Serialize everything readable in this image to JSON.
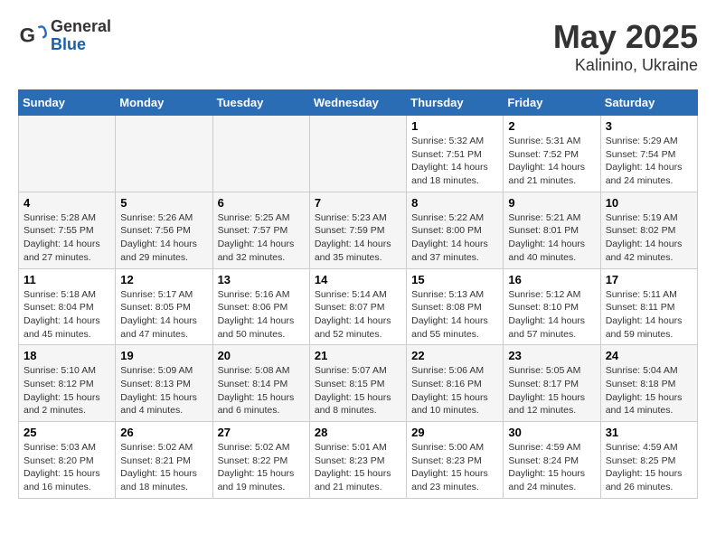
{
  "header": {
    "logo_general": "General",
    "logo_blue": "Blue",
    "title": "May 2025",
    "subtitle": "Kalinino, Ukraine"
  },
  "days_of_week": [
    "Sunday",
    "Monday",
    "Tuesday",
    "Wednesday",
    "Thursday",
    "Friday",
    "Saturday"
  ],
  "weeks": [
    [
      {
        "day": "",
        "info": ""
      },
      {
        "day": "",
        "info": ""
      },
      {
        "day": "",
        "info": ""
      },
      {
        "day": "",
        "info": ""
      },
      {
        "day": "1",
        "info": "Sunrise: 5:32 AM\nSunset: 7:51 PM\nDaylight: 14 hours\nand 18 minutes."
      },
      {
        "day": "2",
        "info": "Sunrise: 5:31 AM\nSunset: 7:52 PM\nDaylight: 14 hours\nand 21 minutes."
      },
      {
        "day": "3",
        "info": "Sunrise: 5:29 AM\nSunset: 7:54 PM\nDaylight: 14 hours\nand 24 minutes."
      }
    ],
    [
      {
        "day": "4",
        "info": "Sunrise: 5:28 AM\nSunset: 7:55 PM\nDaylight: 14 hours\nand 27 minutes."
      },
      {
        "day": "5",
        "info": "Sunrise: 5:26 AM\nSunset: 7:56 PM\nDaylight: 14 hours\nand 29 minutes."
      },
      {
        "day": "6",
        "info": "Sunrise: 5:25 AM\nSunset: 7:57 PM\nDaylight: 14 hours\nand 32 minutes."
      },
      {
        "day": "7",
        "info": "Sunrise: 5:23 AM\nSunset: 7:59 PM\nDaylight: 14 hours\nand 35 minutes."
      },
      {
        "day": "8",
        "info": "Sunrise: 5:22 AM\nSunset: 8:00 PM\nDaylight: 14 hours\nand 37 minutes."
      },
      {
        "day": "9",
        "info": "Sunrise: 5:21 AM\nSunset: 8:01 PM\nDaylight: 14 hours\nand 40 minutes."
      },
      {
        "day": "10",
        "info": "Sunrise: 5:19 AM\nSunset: 8:02 PM\nDaylight: 14 hours\nand 42 minutes."
      }
    ],
    [
      {
        "day": "11",
        "info": "Sunrise: 5:18 AM\nSunset: 8:04 PM\nDaylight: 14 hours\nand 45 minutes."
      },
      {
        "day": "12",
        "info": "Sunrise: 5:17 AM\nSunset: 8:05 PM\nDaylight: 14 hours\nand 47 minutes."
      },
      {
        "day": "13",
        "info": "Sunrise: 5:16 AM\nSunset: 8:06 PM\nDaylight: 14 hours\nand 50 minutes."
      },
      {
        "day": "14",
        "info": "Sunrise: 5:14 AM\nSunset: 8:07 PM\nDaylight: 14 hours\nand 52 minutes."
      },
      {
        "day": "15",
        "info": "Sunrise: 5:13 AM\nSunset: 8:08 PM\nDaylight: 14 hours\nand 55 minutes."
      },
      {
        "day": "16",
        "info": "Sunrise: 5:12 AM\nSunset: 8:10 PM\nDaylight: 14 hours\nand 57 minutes."
      },
      {
        "day": "17",
        "info": "Sunrise: 5:11 AM\nSunset: 8:11 PM\nDaylight: 14 hours\nand 59 minutes."
      }
    ],
    [
      {
        "day": "18",
        "info": "Sunrise: 5:10 AM\nSunset: 8:12 PM\nDaylight: 15 hours\nand 2 minutes."
      },
      {
        "day": "19",
        "info": "Sunrise: 5:09 AM\nSunset: 8:13 PM\nDaylight: 15 hours\nand 4 minutes."
      },
      {
        "day": "20",
        "info": "Sunrise: 5:08 AM\nSunset: 8:14 PM\nDaylight: 15 hours\nand 6 minutes."
      },
      {
        "day": "21",
        "info": "Sunrise: 5:07 AM\nSunset: 8:15 PM\nDaylight: 15 hours\nand 8 minutes."
      },
      {
        "day": "22",
        "info": "Sunrise: 5:06 AM\nSunset: 8:16 PM\nDaylight: 15 hours\nand 10 minutes."
      },
      {
        "day": "23",
        "info": "Sunrise: 5:05 AM\nSunset: 8:17 PM\nDaylight: 15 hours\nand 12 minutes."
      },
      {
        "day": "24",
        "info": "Sunrise: 5:04 AM\nSunset: 8:18 PM\nDaylight: 15 hours\nand 14 minutes."
      }
    ],
    [
      {
        "day": "25",
        "info": "Sunrise: 5:03 AM\nSunset: 8:20 PM\nDaylight: 15 hours\nand 16 minutes."
      },
      {
        "day": "26",
        "info": "Sunrise: 5:02 AM\nSunset: 8:21 PM\nDaylight: 15 hours\nand 18 minutes."
      },
      {
        "day": "27",
        "info": "Sunrise: 5:02 AM\nSunset: 8:22 PM\nDaylight: 15 hours\nand 19 minutes."
      },
      {
        "day": "28",
        "info": "Sunrise: 5:01 AM\nSunset: 8:23 PM\nDaylight: 15 hours\nand 21 minutes."
      },
      {
        "day": "29",
        "info": "Sunrise: 5:00 AM\nSunset: 8:23 PM\nDaylight: 15 hours\nand 23 minutes."
      },
      {
        "day": "30",
        "info": "Sunrise: 4:59 AM\nSunset: 8:24 PM\nDaylight: 15 hours\nand 24 minutes."
      },
      {
        "day": "31",
        "info": "Sunrise: 4:59 AM\nSunset: 8:25 PM\nDaylight: 15 hours\nand 26 minutes."
      }
    ]
  ]
}
